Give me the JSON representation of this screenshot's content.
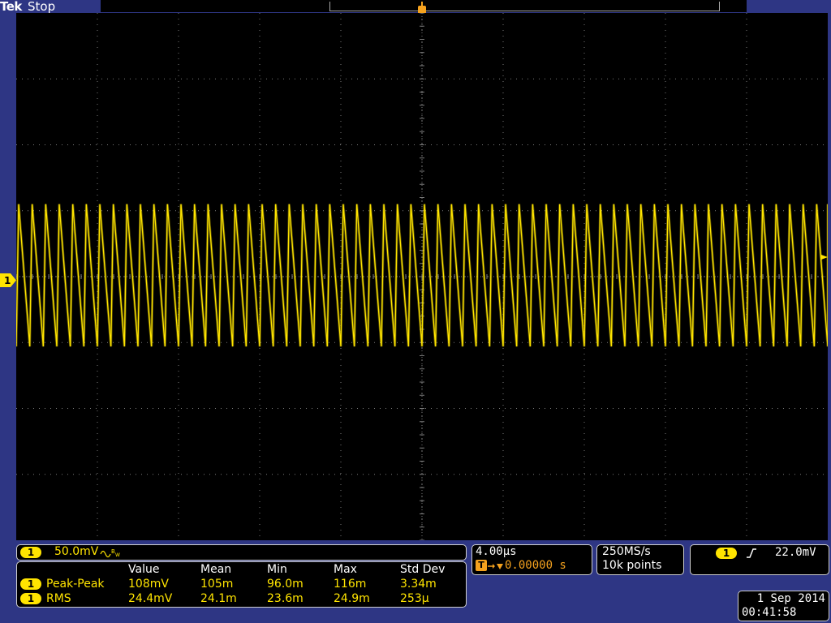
{
  "header": {
    "brand": "Tek",
    "acquisition_state": "Stop",
    "trigger_marker": "T"
  },
  "channel": {
    "number": "1",
    "scale": "50.0mV",
    "bandwidth_icon": "bw-limit-icon",
    "color": "#ffe400"
  },
  "measurements": {
    "columns": [
      "Value",
      "Mean",
      "Min",
      "Max",
      "Std Dev"
    ],
    "rows": [
      {
        "channel": "1",
        "name": "Peak-Peak",
        "values": [
          "108mV",
          "105m",
          "96.0m",
          "116m",
          "3.34m"
        ]
      },
      {
        "channel": "1",
        "name": "RMS",
        "values": [
          "24.4mV",
          "24.1m",
          "23.6m",
          "24.9m",
          "253µ"
        ]
      }
    ]
  },
  "horizontal": {
    "scale": "4.00µs",
    "trigger_position": "0.00000 s",
    "trigger_glyph": "T"
  },
  "acquisition": {
    "sample_rate": "250MS/s",
    "record_length": "10k points"
  },
  "trigger": {
    "source": "1",
    "slope": "rising",
    "level": "22.0mV"
  },
  "datetime": {
    "date": "1 Sep  2014",
    "time": "00:41:58"
  },
  "colors": {
    "background": "#000000",
    "frame": "#2e3684",
    "trace": "#ffe400",
    "trigger": "#f5a21e",
    "grid": "#7a7a7a"
  },
  "chart_data": {
    "type": "line",
    "x_unit": "s",
    "y_unit": "V",
    "x_divisions": 10,
    "y_divisions": 8,
    "time_per_div": "4.00µs",
    "volts_per_div": "50.0mV",
    "series": [
      {
        "name": "",
        "shape": "sawtooth",
        "cycles_on_screen": 60,
        "peak_to_peak_mV": 108,
        "rms_mV": 24.4,
        "approx_high_mV": 55,
        "approx_low_mV": -53
      }
    ]
  }
}
